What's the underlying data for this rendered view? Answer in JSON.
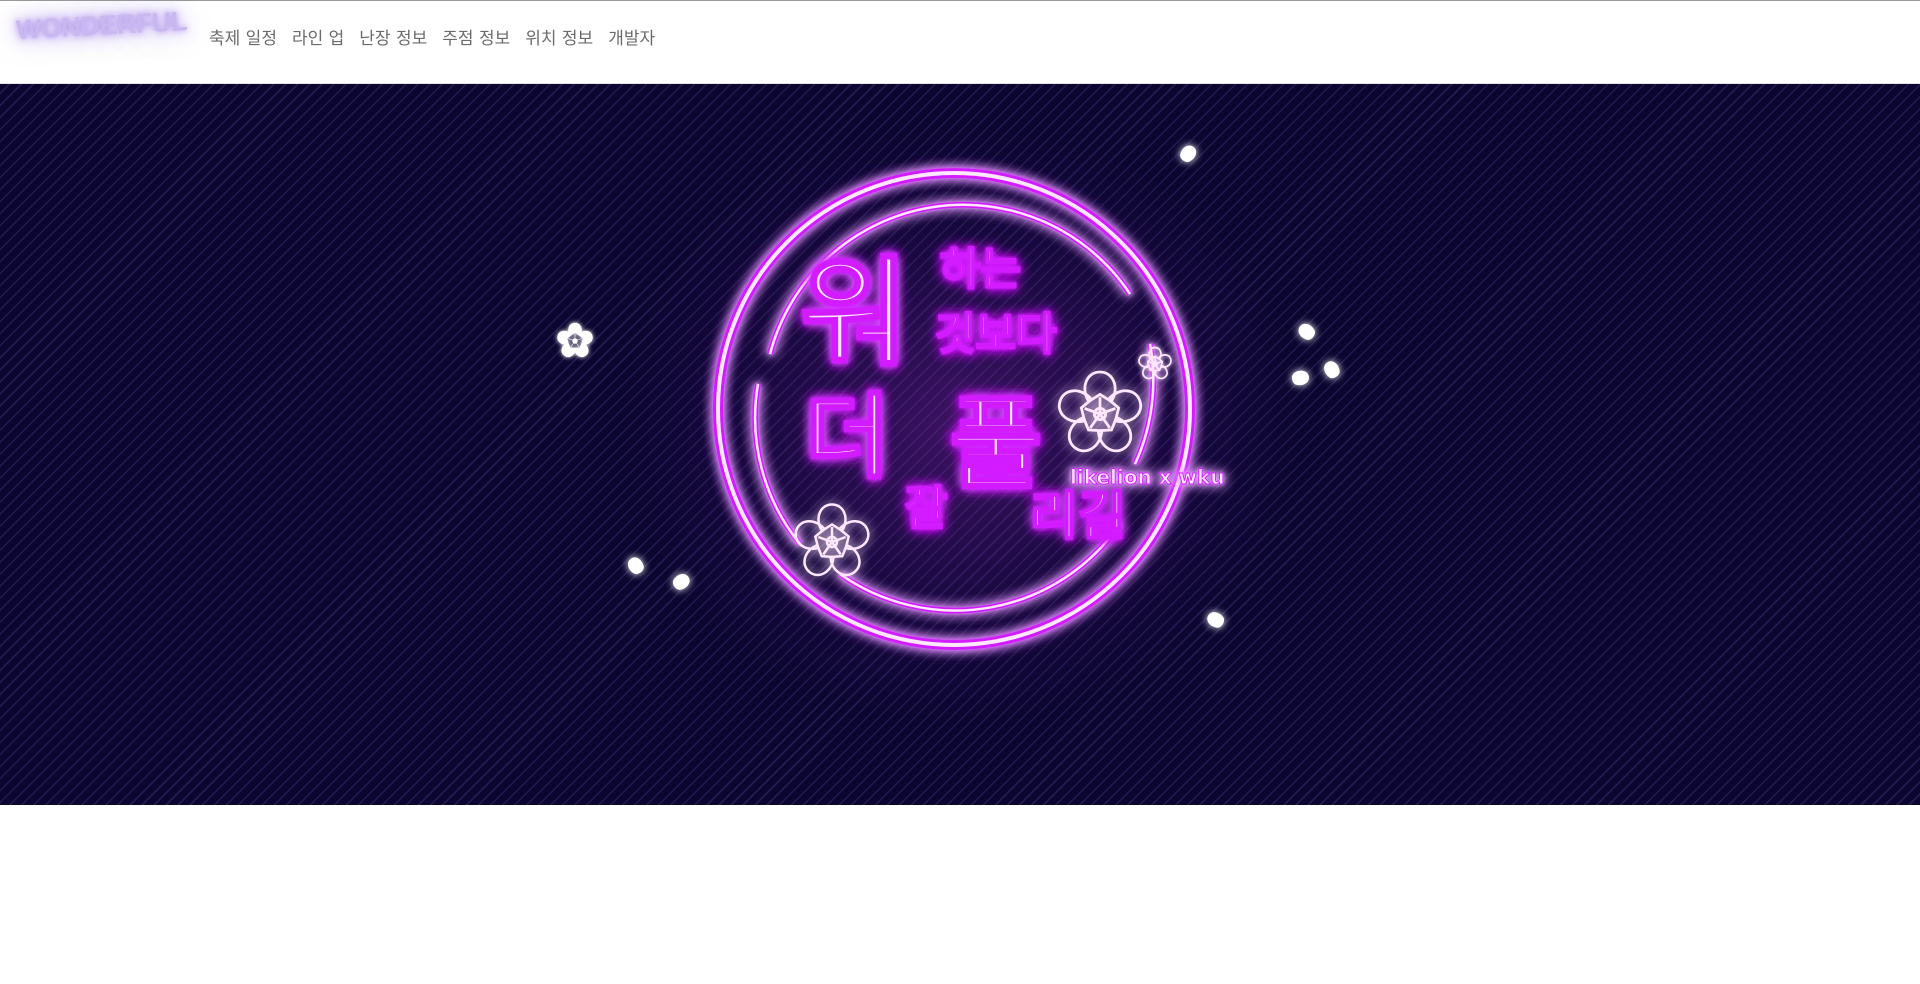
{
  "brand": {
    "label": "WONDERFUL"
  },
  "nav": {
    "items": [
      {
        "label": "축제 일정"
      },
      {
        "label": "라인 업"
      },
      {
        "label": "난장 정보"
      },
      {
        "label": "주점 정보"
      },
      {
        "label": "위치 정보"
      },
      {
        "label": "개발자"
      }
    ]
  },
  "hero": {
    "line1_big": "워",
    "line1_small_a": "하는",
    "line1_small_b": "것보다",
    "line2_big_a": "더",
    "line2_big_b": "풀",
    "line2_small_a": "잘",
    "line2_small_b": "리길",
    "tagline": "likelion x wku",
    "colors": {
      "background": "#0b0630",
      "neon": "#d21cff",
      "neon_core": "#ffe8ff"
    }
  }
}
